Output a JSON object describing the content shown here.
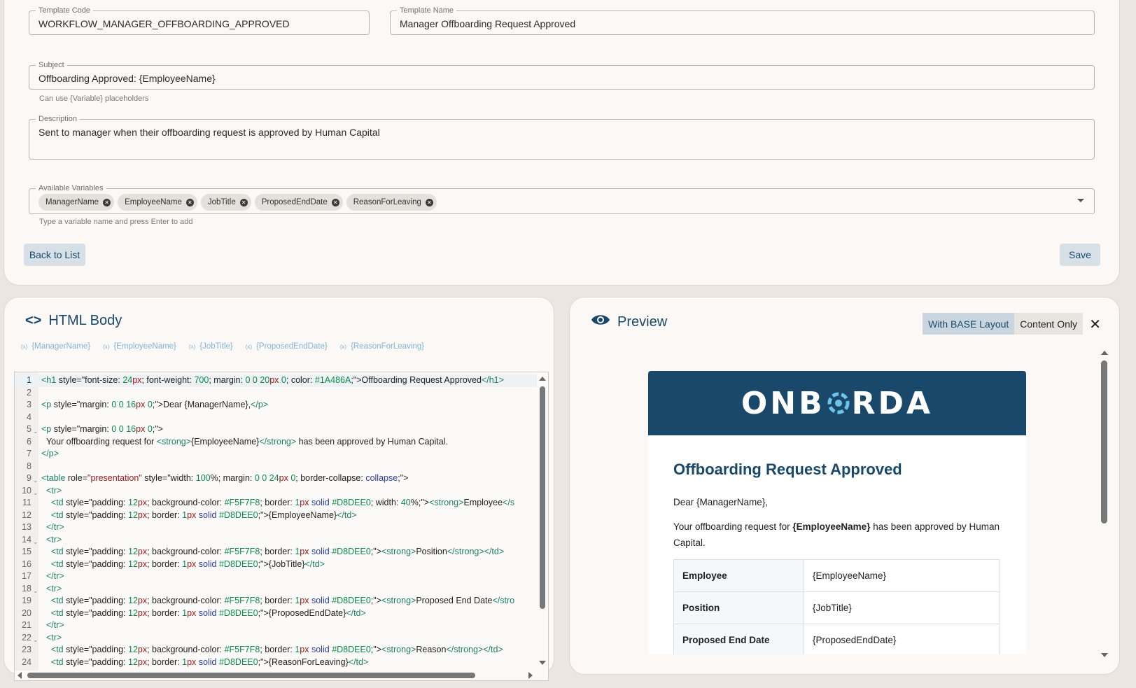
{
  "form": {
    "template_code_label": "Template Code",
    "template_code_value": "WORKFLOW_MANAGER_OFFBOARDING_APPROVED",
    "template_name_label": "Template Name",
    "template_name_value": "Manager Offboarding Request Approved",
    "subject_label": "Subject",
    "subject_value": "Offboarding Approved: {EmployeeName}",
    "subject_helper": "Can use {Variable} placeholders",
    "description_label": "Description",
    "description_value": "Sent to manager when their offboarding request is approved by Human Capital",
    "variables_label": "Available Variables",
    "variables": [
      "ManagerName",
      "EmployeeName",
      "JobTitle",
      "ProposedEndDate",
      "ReasonForLeaving"
    ],
    "variables_helper": "Type a variable name and press Enter to add",
    "back_button": "Back to List",
    "save_button": "Save"
  },
  "html_body": {
    "title": "HTML Body",
    "var_chips": [
      "{ManagerName}",
      "{EmployeeName}",
      "{JobTitle}",
      "{ProposedEndDate}",
      "{ReasonForLeaving}"
    ],
    "lines": [
      {
        "n": "1",
        "fold": false,
        "html": "<span class='c-tag'>&lt;h1</span> style=\"font-size: <span class='c-num'>24</span><span class='c-red'>px</span>; font-weight: <span class='c-num'>700</span>; margin: <span class='c-num'>0</span> <span class='c-num'>0</span> <span class='c-num'>20</span><span class='c-red'>px</span> <span class='c-num'>0</span>; color: <span class='c-num'>#1A486A</span>;\"&gt;Offboarding Request Approved<span class='c-tag'>&lt;/h1&gt;</span>"
      },
      {
        "n": "2",
        "fold": false,
        "html": ""
      },
      {
        "n": "3",
        "fold": false,
        "html": "<span class='c-tag'>&lt;p</span> style=\"margin: <span class='c-num'>0</span> <span class='c-num'>0</span> <span class='c-num'>16</span><span class='c-red'>px</span> <span class='c-num'>0</span>;\"&gt;Dear {ManagerName},<span class='c-tag'>&lt;/p&gt;</span>"
      },
      {
        "n": "4",
        "fold": false,
        "html": ""
      },
      {
        "n": "5",
        "fold": true,
        "html": "<span class='c-tag'>&lt;p</span> style=\"margin: <span class='c-num'>0</span> <span class='c-num'>0</span> <span class='c-num'>16</span><span class='c-red'>px</span> <span class='c-num'>0</span>;\"&gt;"
      },
      {
        "n": "6",
        "fold": false,
        "html": "&nbsp;&nbsp;Your offboarding request for <span class='c-tag'>&lt;strong&gt;</span>{EmployeeName}<span class='c-tag'>&lt;/strong&gt;</span> has been approved by Human Capital."
      },
      {
        "n": "7",
        "fold": false,
        "html": "<span class='c-tag'>&lt;/p&gt;</span>"
      },
      {
        "n": "8",
        "fold": false,
        "html": ""
      },
      {
        "n": "9",
        "fold": true,
        "html": "<span class='c-tag'>&lt;table</span> role=<span class='c-red'>\"presentation\"</span> style=\"width: <span class='c-num'>100</span>%; margin: <span class='c-num'>0</span> <span class='c-num'>0</span> <span class='c-num'>24</span><span class='c-red'>px</span> <span class='c-num'>0</span>; border-collapse: <span class='c-kw'>collapse</span>;\"&gt;"
      },
      {
        "n": "10",
        "fold": true,
        "html": "&nbsp;&nbsp;<span class='c-tag'>&lt;tr&gt;</span>"
      },
      {
        "n": "11",
        "fold": false,
        "html": "&nbsp;&nbsp;&nbsp;&nbsp;<span class='c-tag'>&lt;td</span> style=\"padding: <span class='c-num'>12</span><span class='c-red'>px</span>; background-color: <span class='c-num'>#F5F7F8</span>; border: <span class='c-num'>1</span><span class='c-red'>px</span> <span class='c-kw'>solid</span> <span class='c-num'>#D8DEE0</span>; width: <span class='c-num'>40</span>%;\"&gt;<span class='c-tag'>&lt;strong&gt;</span>Employee<span class='c-tag'>&lt;/s</span>"
      },
      {
        "n": "12",
        "fold": false,
        "html": "&nbsp;&nbsp;&nbsp;&nbsp;<span class='c-tag'>&lt;td</span> style=\"padding: <span class='c-num'>12</span><span class='c-red'>px</span>; border: <span class='c-num'>1</span><span class='c-red'>px</span> <span class='c-kw'>solid</span> <span class='c-num'>#D8DEE0</span>;\"&gt;{EmployeeName}<span class='c-tag'>&lt;/td&gt;</span>"
      },
      {
        "n": "13",
        "fold": false,
        "html": "&nbsp;&nbsp;<span class='c-tag'>&lt;/tr&gt;</span>"
      },
      {
        "n": "14",
        "fold": true,
        "html": "&nbsp;&nbsp;<span class='c-tag'>&lt;tr&gt;</span>"
      },
      {
        "n": "15",
        "fold": false,
        "html": "&nbsp;&nbsp;&nbsp;&nbsp;<span class='c-tag'>&lt;td</span> style=\"padding: <span class='c-num'>12</span><span class='c-red'>px</span>; background-color: <span class='c-num'>#F5F7F8</span>; border: <span class='c-num'>1</span><span class='c-red'>px</span> <span class='c-kw'>solid</span> <span class='c-num'>#D8DEE0</span>;\"&gt;<span class='c-tag'>&lt;strong&gt;</span>Position<span class='c-tag'>&lt;/strong&gt;&lt;/td&gt;</span>"
      },
      {
        "n": "16",
        "fold": false,
        "html": "&nbsp;&nbsp;&nbsp;&nbsp;<span class='c-tag'>&lt;td</span> style=\"padding: <span class='c-num'>12</span><span class='c-red'>px</span>; border: <span class='c-num'>1</span><span class='c-red'>px</span> <span class='c-kw'>solid</span> <span class='c-num'>#D8DEE0</span>;\"&gt;{JobTitle}<span class='c-tag'>&lt;/td&gt;</span>"
      },
      {
        "n": "17",
        "fold": false,
        "html": "&nbsp;&nbsp;<span class='c-tag'>&lt;/tr&gt;</span>"
      },
      {
        "n": "18",
        "fold": true,
        "html": "&nbsp;&nbsp;<span class='c-tag'>&lt;tr&gt;</span>"
      },
      {
        "n": "19",
        "fold": false,
        "html": "&nbsp;&nbsp;&nbsp;&nbsp;<span class='c-tag'>&lt;td</span> style=\"padding: <span class='c-num'>12</span><span class='c-red'>px</span>; background-color: <span class='c-num'>#F5F7F8</span>; border: <span class='c-num'>1</span><span class='c-red'>px</span> <span class='c-kw'>solid</span> <span class='c-num'>#D8DEE0</span>;\"&gt;<span class='c-tag'>&lt;strong&gt;</span>Proposed End Date<span class='c-tag'>&lt;/stro</span>"
      },
      {
        "n": "20",
        "fold": false,
        "html": "&nbsp;&nbsp;&nbsp;&nbsp;<span class='c-tag'>&lt;td</span> style=\"padding: <span class='c-num'>12</span><span class='c-red'>px</span>; border: <span class='c-num'>1</span><span class='c-red'>px</span> <span class='c-kw'>solid</span> <span class='c-num'>#D8DEE0</span>;\"&gt;{ProposedEndDate}<span class='c-tag'>&lt;/td&gt;</span>"
      },
      {
        "n": "21",
        "fold": false,
        "html": "&nbsp;&nbsp;<span class='c-tag'>&lt;/tr&gt;</span>"
      },
      {
        "n": "22",
        "fold": true,
        "html": "&nbsp;&nbsp;<span class='c-tag'>&lt;tr&gt;</span>"
      },
      {
        "n": "23",
        "fold": false,
        "html": "&nbsp;&nbsp;&nbsp;&nbsp;<span class='c-tag'>&lt;td</span> style=\"padding: <span class='c-num'>12</span><span class='c-red'>px</span>; background-color: <span class='c-num'>#F5F7F8</span>; border: <span class='c-num'>1</span><span class='c-red'>px</span> <span class='c-kw'>solid</span> <span class='c-num'>#D8DEE0</span>;\"&gt;<span class='c-tag'>&lt;strong&gt;</span>Reason<span class='c-tag'>&lt;/strong&gt;&lt;/td&gt;</span>"
      },
      {
        "n": "24",
        "fold": false,
        "html": "&nbsp;&nbsp;&nbsp;&nbsp;<span class='c-tag'>&lt;td</span> style=\"padding: <span class='c-num'>12</span><span class='c-red'>px</span>; border: <span class='c-num'>1</span><span class='c-red'>px</span> <span class='c-kw'>solid</span> <span class='c-num'>#D8DEE0</span>;\"&gt;{ReasonForLeaving}<span class='c-tag'>&lt;/td&gt;</span>"
      }
    ]
  },
  "preview": {
    "title": "Preview",
    "toggle_base": "With BASE Layout",
    "toggle_content": "Content Only",
    "logo_left": "ONB",
    "logo_right": "RDA",
    "email_heading": "Offboarding Request Approved",
    "greeting": "Dear {ManagerName},",
    "para_before": "Your offboarding request for ",
    "para_strong": "{EmployeeName}",
    "para_after": " has been approved by Human Capital.",
    "rows": [
      {
        "k": "Employee",
        "v": "{EmployeeName}"
      },
      {
        "k": "Position",
        "v": "{JobTitle}"
      },
      {
        "k": "Proposed End Date",
        "v": "{ProposedEndDate}"
      }
    ]
  },
  "colors": {
    "brand": "#1A486A",
    "accent": "#6EC3EA",
    "table_border": "#D8DEE0",
    "table_key_bg": "#F5F7F8"
  }
}
